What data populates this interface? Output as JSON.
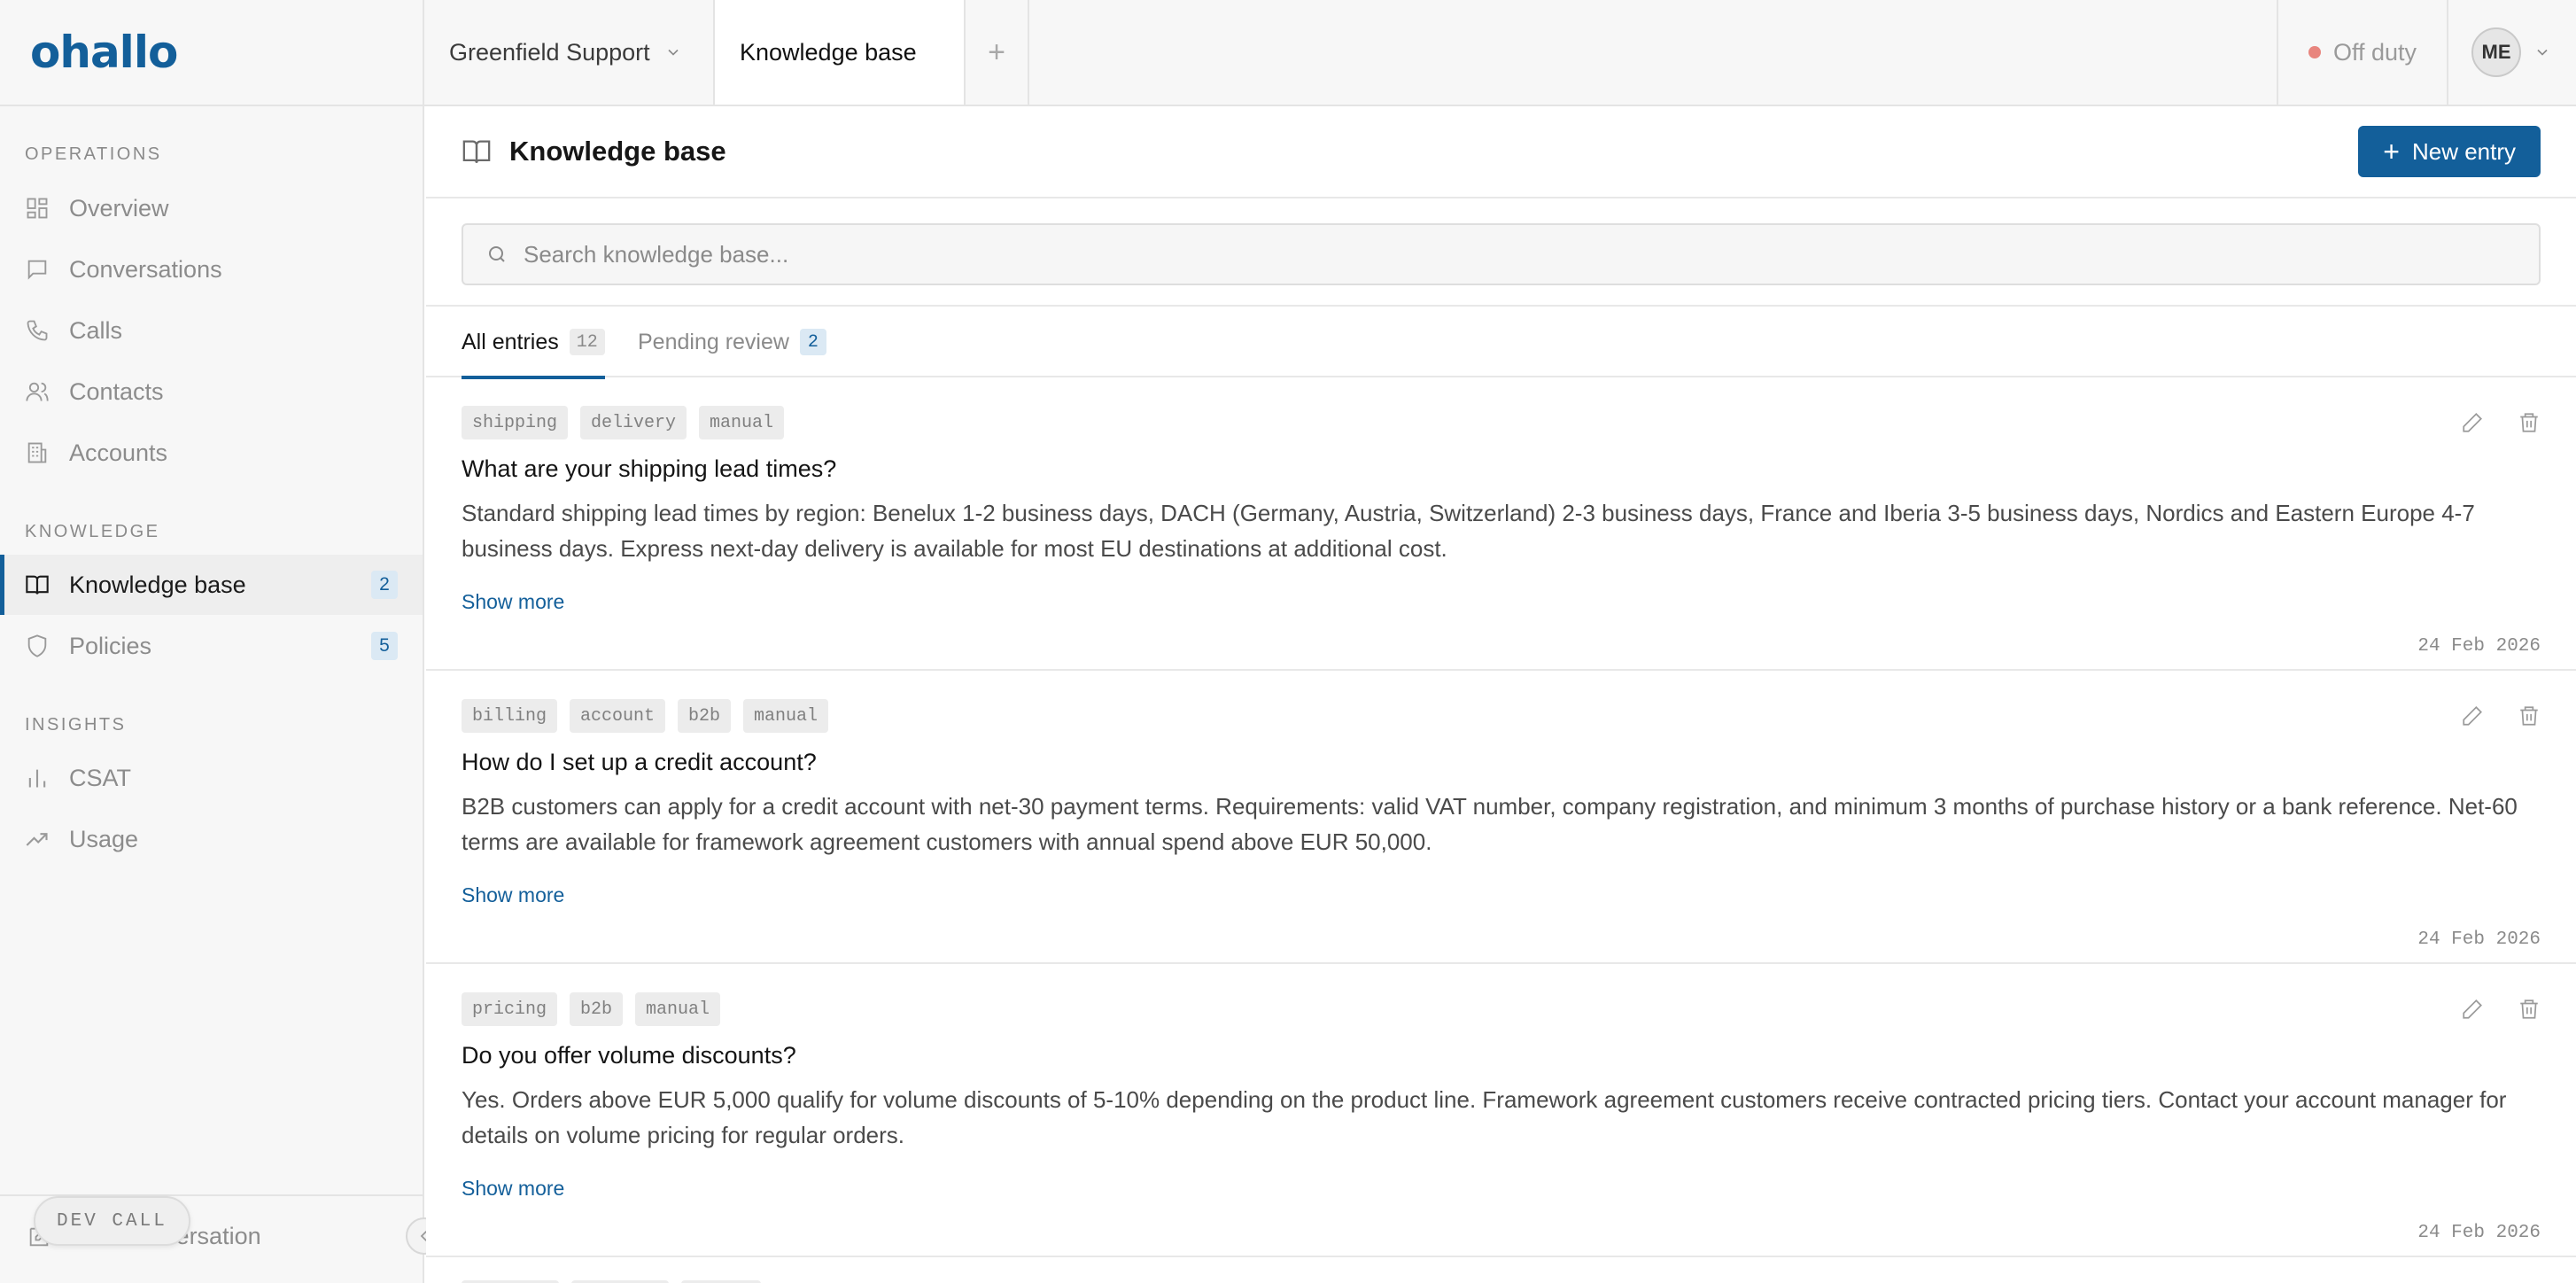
{
  "brand": {
    "name": "ohallo",
    "color": "#135f9a"
  },
  "sidebar": {
    "sections": [
      {
        "label": "OPERATIONS"
      },
      {
        "label": "KNOWLEDGE"
      },
      {
        "label": "INSIGHTS"
      }
    ],
    "items": [
      {
        "label": "Overview",
        "icon": "grid-icon"
      },
      {
        "label": "Conversations",
        "icon": "chat-icon"
      },
      {
        "label": "Calls",
        "icon": "phone-icon"
      },
      {
        "label": "Contacts",
        "icon": "users-icon"
      },
      {
        "label": "Accounts",
        "icon": "building-icon"
      },
      {
        "label": "Knowledge base",
        "icon": "book-icon",
        "badge": "2",
        "active": true
      },
      {
        "label": "Policies",
        "icon": "shield-icon",
        "badge": "5"
      },
      {
        "label": "CSAT",
        "icon": "bar-chart-icon"
      },
      {
        "label": "Usage",
        "icon": "trend-icon"
      }
    ],
    "footer": {
      "new_conversation": "New conversation",
      "dev_call": "DEV CALL"
    }
  },
  "topbar": {
    "workspace": "Greenfield Support",
    "active_tab": "Knowledge base",
    "add_tab": "+",
    "status": "Off duty",
    "status_color": "#e8857e",
    "user_initials": "ME"
  },
  "page": {
    "title": "Knowledge base",
    "new_entry": "New entry",
    "search_placeholder": "Search knowledge base...",
    "tabs": [
      {
        "label": "All entries",
        "count": "12",
        "active": true
      },
      {
        "label": "Pending review",
        "count": "2",
        "active": false
      }
    ]
  },
  "entries": [
    {
      "tags": [
        "shipping",
        "delivery",
        "manual"
      ],
      "title": "What are your shipping lead times?",
      "body": "Standard shipping lead times by region: Benelux 1-2 business days, DACH (Germany, Austria, Switzerland) 2-3 business days, France and Iberia 3-5 business days, Nordics and Eastern Europe 4-7 business days. Express next-day delivery is available for most EU destinations at additional cost.",
      "show_more": "Show more",
      "date": "24 Feb 2026"
    },
    {
      "tags": [
        "billing",
        "account",
        "b2b",
        "manual"
      ],
      "title": "How do I set up a credit account?",
      "body": "B2B customers can apply for a credit account with net-30 payment terms. Requirements: valid VAT number, company registration, and minimum 3 months of purchase history or a bank reference. Net-60 terms are available for framework agreement customers with annual spend above EUR 50,000.",
      "show_more": "Show more",
      "date": "24 Feb 2026"
    },
    {
      "tags": [
        "pricing",
        "b2b",
        "manual"
      ],
      "title": "Do you offer volume discounts?",
      "body": "Yes. Orders above EUR 5,000 qualify for volume discounts of 5-10% depending on the product line. Framework agreement customers receive contracted pricing tiers. Contact your account manager for details on volume pricing for regular orders.",
      "show_more": "Show more",
      "date": "24 Feb 2026"
    }
  ]
}
